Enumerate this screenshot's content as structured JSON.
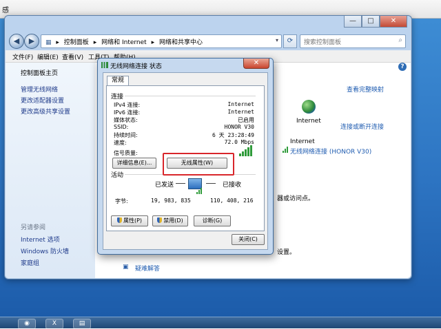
{
  "top": {
    "title_fragment": "感"
  },
  "window": {
    "minimize": "—",
    "maximize": "□",
    "close": "✕",
    "breadcrumbs": [
      "控制面板",
      "▸",
      "网络和 Internet",
      "▸",
      "网络和共享中心",
      "▾"
    ],
    "search_placeholder": "搜索控制面板",
    "menu": [
      "文件(F)",
      "编辑(E)",
      "查看(V)",
      "工具(T)",
      "帮助(H)"
    ]
  },
  "left_pane": {
    "home": "控制面板主页",
    "links": [
      "管理无线网络",
      "更改适配器设置",
      "更改高级共享设置"
    ],
    "see_also_title": "另请参阅",
    "see_also": [
      "Internet 选项",
      "Windows 防火墙",
      "家庭组"
    ]
  },
  "right_pane": {
    "view_map": "查看完整映射",
    "internet": "Internet",
    "connect_disconnect": "连接或断开连接",
    "access_label": "Internet",
    "connection_link": "无线网络连接 (HONOR V30)",
    "frag_access": "器或访问点。",
    "frag_settings": "设置。",
    "troubleshoot": "疑难解答"
  },
  "dialog": {
    "title": "无线网络连接 状态",
    "close": "✕",
    "tab": "常规",
    "connection_section": "连接",
    "rows": [
      {
        "label": "IPv4 连接:",
        "value": "Internet"
      },
      {
        "label": "IPv6 连接:",
        "value": "Internet"
      },
      {
        "label": "媒体状态:",
        "value": "已启用"
      },
      {
        "label": "SSID:",
        "value": "HONOR V30"
      },
      {
        "label": "持续时间:",
        "value": "6 天 23:28:49"
      },
      {
        "label": "速度:",
        "value": "72.0 Mbps"
      }
    ],
    "signal_label": "信号质量:",
    "signal_bars": 5,
    "details_button": "详细信息(E)...",
    "wireless_props_button": "无线属性(W)",
    "activity_section": "活动",
    "sent_label": "已发送",
    "received_label": "已接收",
    "bytes_label": "字节:",
    "bytes_sent": "19, 983, 835",
    "bytes_received": "110, 408, 216",
    "properties_button": "属性(P)",
    "disable_button": "禁用(D)",
    "diagnose_button": "诊断(G)",
    "close_button": "关闭(C)"
  },
  "colors": {
    "highlight": "#d8252a",
    "link": "#1e5bb0",
    "signal": "#2f9b3a"
  }
}
